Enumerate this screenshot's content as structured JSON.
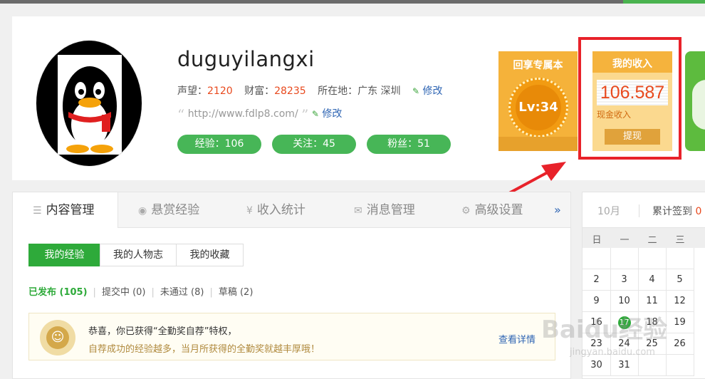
{
  "profile": {
    "username": "duguyilangxi",
    "reputation_label": "声望：",
    "reputation_value": "2120",
    "wealth_label": "财富：",
    "wealth_value": "28235",
    "location_label": "所在地：",
    "location_value": "广东 深圳",
    "edit_label": "修改",
    "url": "http://www.fdlp8.com/",
    "url_edit_label": "修改",
    "pills": [
      {
        "label": "经验：106"
      },
      {
        "label": "关注：45"
      },
      {
        "label": "粉丝：51"
      }
    ]
  },
  "level_card": {
    "title": "回享专属本",
    "level": "Lv:34"
  },
  "income_card": {
    "title": "我的收入",
    "amount": "106.587",
    "label": "现金收入",
    "withdraw": "提现"
  },
  "tabs": [
    {
      "label": "内容管理",
      "icon": "list-icon"
    },
    {
      "label": "悬赏经验",
      "icon": "coin-icon"
    },
    {
      "label": "收入统计",
      "icon": "yen-icon"
    },
    {
      "label": "消息管理",
      "icon": "mail-icon"
    },
    {
      "label": "高级设置",
      "icon": "gear-icon"
    }
  ],
  "tab_more": "»",
  "subtabs": [
    {
      "label": "我的经验"
    },
    {
      "label": "我的人物志"
    },
    {
      "label": "我的收藏"
    }
  ],
  "filters": [
    {
      "label": "已发布 (105)"
    },
    {
      "label": "提交中 (0)"
    },
    {
      "label": "未通过 (8)"
    },
    {
      "label": "草稿 (2)"
    }
  ],
  "notice": {
    "line1": "恭喜，你已获得“全勤奖自荐”特权，",
    "line2": "自荐成功的经验越多，当月所获得的全勤奖就越丰厚哦！",
    "detail": "查看详情"
  },
  "calendar": {
    "month": "10月",
    "total_label": "累计签到",
    "total_value": "0",
    "weekdays": [
      "日",
      "一",
      "二",
      "三"
    ],
    "rows": [
      [
        "",
        "",
        "",
        ""
      ],
      [
        "2",
        "3",
        "4",
        "5"
      ],
      [
        "9",
        "10",
        "11",
        "12"
      ],
      [
        "16",
        "17",
        "18",
        "19"
      ],
      [
        "23",
        "24",
        "25",
        "26"
      ],
      [
        "30",
        "31",
        "",
        ""
      ]
    ],
    "signed_day": "17"
  },
  "watermark": {
    "brand": "Baidu经验",
    "url": "jingyan.baidu.com"
  },
  "colors": {
    "accent_green": "#2eaa3a",
    "highlight_red": "#e8222a",
    "number_orange": "#e8491d",
    "link_blue": "#2d64b3"
  }
}
